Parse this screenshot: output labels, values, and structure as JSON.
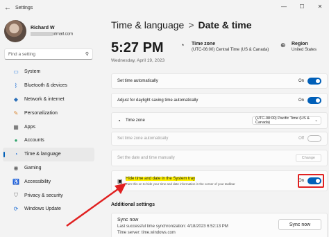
{
  "window": {
    "title": "Settings",
    "back_icon": "back-arrow-icon"
  },
  "profile": {
    "name": "Richard W",
    "email_suffix": "otmail.com"
  },
  "search": {
    "placeholder": "Find a setting"
  },
  "nav": [
    {
      "label": "System",
      "icon": "monitor-icon"
    },
    {
      "label": "Bluetooth & devices",
      "icon": "bluetooth-icon"
    },
    {
      "label": "Network & internet",
      "icon": "wifi-icon"
    },
    {
      "label": "Personalization",
      "icon": "brush-icon"
    },
    {
      "label": "Apps",
      "icon": "apps-icon"
    },
    {
      "label": "Accounts",
      "icon": "person-icon"
    },
    {
      "label": "Time & language",
      "icon": "globe-clock-icon",
      "active": true
    },
    {
      "label": "Gaming",
      "icon": "controller-icon"
    },
    {
      "label": "Accessibility",
      "icon": "accessibility-icon"
    },
    {
      "label": "Privacy & security",
      "icon": "shield-icon"
    },
    {
      "label": "Windows Update",
      "icon": "update-icon"
    }
  ],
  "breadcrumb": {
    "parent": "Time & language",
    "separator": ">",
    "current": "Date & time"
  },
  "header": {
    "time": "5:27 PM",
    "date": "Wednesday, April 19, 2023",
    "timezone_title": "Time zone",
    "timezone_value": "(UTC-06:00) Central Time (US & Canada)",
    "region_title": "Region",
    "region_value": "United States"
  },
  "settings": {
    "auto_time": {
      "label": "Set time automatically",
      "state": "On"
    },
    "dst": {
      "label": "Adjust for daylight saving time automatically",
      "state": "On"
    },
    "timezone": {
      "label": "Time zone",
      "value": "(UTC-08:00) Pacific Time (US & Canada)"
    },
    "auto_tz": {
      "label": "Set time zone automatically",
      "state": "Off"
    },
    "manual": {
      "label": "Set the date and time manually",
      "button": "Change"
    },
    "tray": {
      "label": "Hide time and date in the System tray",
      "description": "Turn this on to hide your time and date information in the corner of your taskbar",
      "state": "On"
    }
  },
  "additional": {
    "heading": "Additional settings",
    "sync_title": "Sync now",
    "last_sync": "Last successful time synchronization: 4/18/2023 6:52:13 PM",
    "time_server": "Time server: time.windows.com",
    "sync_button": "Sync now"
  },
  "colors": {
    "accent": "#005fb8",
    "annotation": "#e02020",
    "highlight": "#fff200"
  }
}
